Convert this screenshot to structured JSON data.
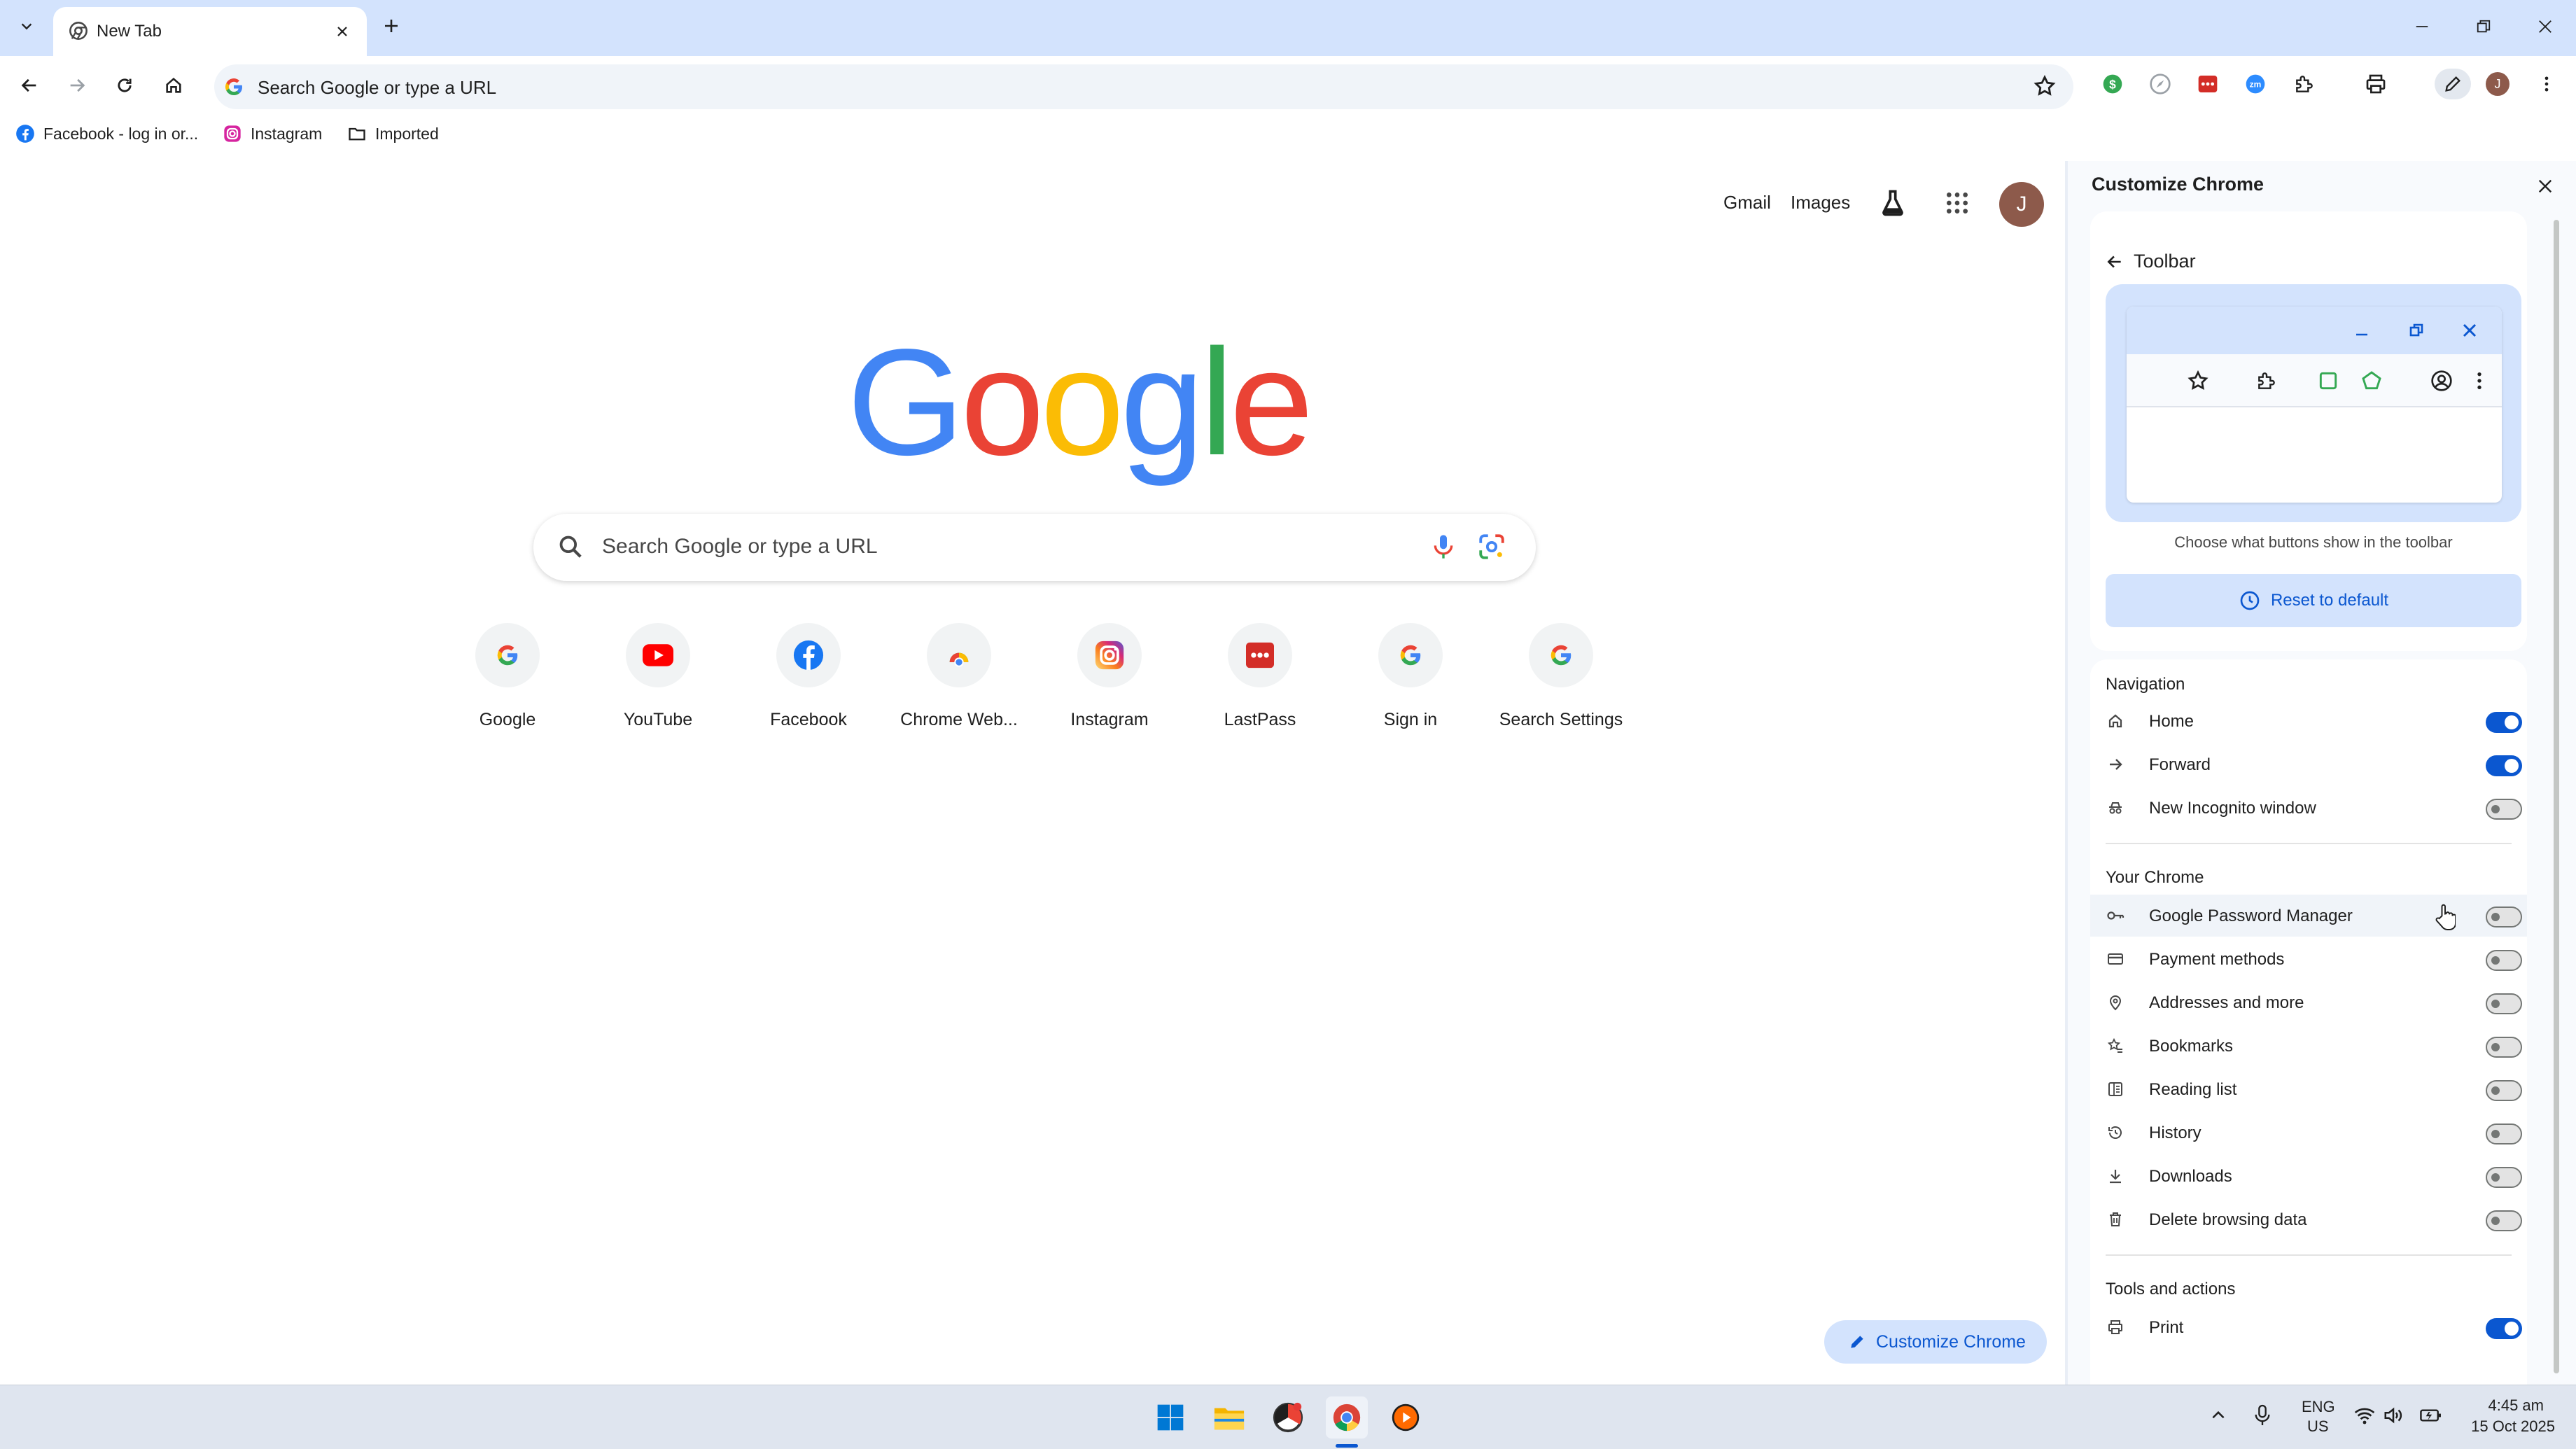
{
  "tab": {
    "title": "New Tab"
  },
  "omnibox": {
    "placeholder": "Search Google or type a URL"
  },
  "bookmarks": [
    {
      "label": "Facebook - log in or..."
    },
    {
      "label": "Instagram"
    },
    {
      "label": "Imported"
    }
  ],
  "ntp": {
    "gmail": "Gmail",
    "images": "Images",
    "avatar_letter": "J",
    "search_placeholder": "Search Google or type a URL",
    "shortcuts": [
      {
        "label": "Google"
      },
      {
        "label": "YouTube"
      },
      {
        "label": "Facebook"
      },
      {
        "label": "Chrome Web..."
      },
      {
        "label": "Instagram"
      },
      {
        "label": "LastPass"
      },
      {
        "label": "Sign in"
      },
      {
        "label": "Search Settings"
      }
    ],
    "customize_label": "Customize Chrome"
  },
  "panel": {
    "title": "Customize Chrome",
    "back_label": "Toolbar",
    "choose_text": "Choose what buttons show in the toolbar",
    "reset_label": "Reset to default",
    "sections": {
      "navigation": "Navigation",
      "your_chrome": "Your Chrome",
      "tools": "Tools and actions"
    },
    "navigation": [
      {
        "label": "Home",
        "on": true,
        "icon": "home-icon"
      },
      {
        "label": "Forward",
        "on": true,
        "icon": "forward-arrow-icon"
      },
      {
        "label": "New Incognito window",
        "on": false,
        "icon": "incognito-icon"
      }
    ],
    "your_chrome": [
      {
        "label": "Google Password Manager",
        "on": false,
        "icon": "key-icon"
      },
      {
        "label": "Payment methods",
        "on": false,
        "icon": "credit-card-icon"
      },
      {
        "label": "Addresses and more",
        "on": false,
        "icon": "location-pin-icon"
      },
      {
        "label": "Bookmarks",
        "on": false,
        "icon": "star-list-icon"
      },
      {
        "label": "Reading list",
        "on": false,
        "icon": "reading-list-icon"
      },
      {
        "label": "History",
        "on": false,
        "icon": "history-icon"
      },
      {
        "label": "Downloads",
        "on": false,
        "icon": "download-icon"
      },
      {
        "label": "Delete browsing data",
        "on": false,
        "icon": "trash-icon"
      }
    ],
    "tools": [
      {
        "label": "Print",
        "on": true,
        "icon": "printer-icon"
      }
    ]
  },
  "taskbar": {
    "lang_top": "ENG",
    "lang_bottom": "US",
    "time": "4:45 am",
    "date": "15 Oct 2025"
  },
  "colors": {
    "accent": "#0b57d0",
    "tabstrip": "#d3e3fd",
    "avatar": "#8d5a4b"
  }
}
